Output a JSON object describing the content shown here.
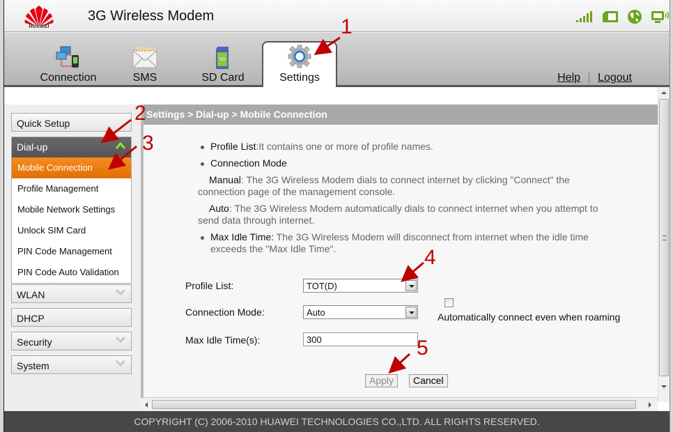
{
  "header": {
    "brand": "HUAWEI",
    "title": "3G Wireless Modem",
    "status_icons": [
      "signal-strength-icon",
      "sim-card-icon",
      "internet-globe-icon",
      "wireless-device-icon"
    ],
    "accent_color": "#6aa51e"
  },
  "nav": {
    "tabs": [
      {
        "label": "Connection",
        "icon": "connection-icon",
        "active": false
      },
      {
        "label": "SMS",
        "icon": "envelope-icon",
        "active": false
      },
      {
        "label": "SD Card",
        "icon": "sd-card-icon",
        "active": false
      },
      {
        "label": "Settings",
        "icon": "gear-icon",
        "active": true
      }
    ],
    "links": {
      "help": "Help",
      "logout": "Logout"
    }
  },
  "sidebar": {
    "quick_setup": "Quick Setup",
    "dialup": {
      "label": "Dial-up",
      "expanded": true,
      "items": [
        {
          "label": "Mobile Connection",
          "active": true
        },
        {
          "label": "Profile Management",
          "active": false
        },
        {
          "label": "Mobile Network Settings",
          "active": false
        },
        {
          "label": "Unlock SIM Card",
          "active": false
        },
        {
          "label": "PIN Code Management",
          "active": false
        },
        {
          "label": "PIN Code Auto Validation",
          "active": false
        }
      ]
    },
    "sections": [
      {
        "label": "WLAN",
        "has_chevron": true
      },
      {
        "label": "DHCP",
        "has_chevron": false
      },
      {
        "label": "Security",
        "has_chevron": true
      },
      {
        "label": "System",
        "has_chevron": true
      }
    ],
    "active_color": "#f07d10"
  },
  "main": {
    "breadcrumb": "Settings > Dial-up > Mobile Connection",
    "help": {
      "profile_list_term": "Profile List",
      "profile_list_text": ":It contains one or more of profile names.",
      "connection_mode_term": "Connection Mode",
      "manual_term": "Manual",
      "manual_text": ": The 3G Wireless Modem dials to connect internet by clicking \"Connect\" the connection page of the management console.",
      "auto_term": "Auto",
      "auto_text": ": The 3G Wireless Modem automatically dials to connect internet when you attempt to send data through internet.",
      "max_idle_term": "Max Idle Time:",
      "max_idle_text": " The 3G Wireless Modem will disconnect from internet when the idle time exceeds the \"Max Idle Time\"."
    },
    "form": {
      "profile_list_label": "Profile List:",
      "profile_list_value": "TOT(D)",
      "connection_mode_label": "Connection Mode:",
      "connection_mode_value": "Auto",
      "roaming_checked": false,
      "roaming_label": "Automatically connect even when roaming",
      "max_idle_label": "Max Idle Time(s):",
      "max_idle_value": "300",
      "apply_label": "Apply",
      "cancel_label": "Cancel"
    }
  },
  "footer": {
    "copyright": "COPYRIGHT (C) 2006-2010 HUAWEI TECHNOLOGIES CO.,LTD. ALL RIGHTS RESERVED."
  },
  "annotations": {
    "color": "#c00000",
    "steps": [
      "1",
      "2",
      "3",
      "4",
      "5"
    ]
  }
}
